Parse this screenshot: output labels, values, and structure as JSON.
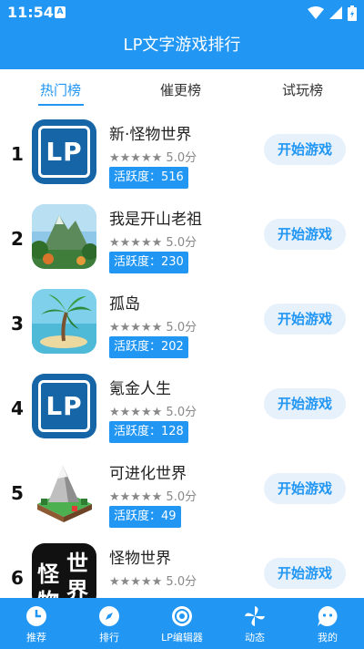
{
  "status_bar": {
    "time": "11:54",
    "notification_letter": "A"
  },
  "app_bar": {
    "title": "LP文字游戏排行"
  },
  "tabs": [
    {
      "label": "热门榜",
      "active": true
    },
    {
      "label": "催更榜",
      "active": false
    },
    {
      "label": "试玩榜",
      "active": false
    }
  ],
  "games": [
    {
      "rank": "1",
      "name": "新·怪物世界",
      "stars": "★★★★★",
      "rating": "5.0分",
      "activity": "活跃度：516",
      "button": "开始游戏",
      "icon": "lp-logo-icon",
      "icon_text": "LP"
    },
    {
      "rank": "2",
      "name": "我是开山老祖",
      "stars": "★★★★★",
      "rating": "5.0分",
      "activity": "活跃度：230",
      "button": "开始游戏",
      "icon": "mountain-landscape-icon"
    },
    {
      "rank": "3",
      "name": "孤岛",
      "stars": "★★★★★",
      "rating": "5.0分",
      "activity": "活跃度：202",
      "button": "开始游戏",
      "icon": "palm-island-icon"
    },
    {
      "rank": "4",
      "name": "氪金人生",
      "stars": "★★★★★",
      "rating": "5.0分",
      "activity": "活跃度：128",
      "button": "开始游戏",
      "icon": "lp-logo-icon",
      "icon_text": "LP"
    },
    {
      "rank": "5",
      "name": "可进化世界",
      "stars": "★★★★★",
      "rating": "5.0分",
      "activity": "活跃度：49",
      "button": "开始游戏",
      "icon": "voxel-mountain-icon"
    },
    {
      "rank": "6",
      "name": "怪物世界",
      "stars": "★★★★★",
      "rating": "5.0分",
      "activity": "",
      "button": "开始游戏",
      "icon": "monster-world-text-icon",
      "icon_text": [
        "世",
        "界",
        "怪",
        "物"
      ]
    }
  ],
  "bottom_nav": [
    {
      "label": "推荐",
      "icon": "clock-icon"
    },
    {
      "label": "排行",
      "icon": "compass-icon"
    },
    {
      "label": "LP编辑器",
      "icon": "target-icon"
    },
    {
      "label": "动态",
      "icon": "pinwheel-icon"
    },
    {
      "label": "我的",
      "icon": "chat-face-icon"
    }
  ],
  "colors": {
    "primary": "#2196f3",
    "button_bg": "#e6f1fc",
    "lp_icon_bg": "#1565a7"
  }
}
